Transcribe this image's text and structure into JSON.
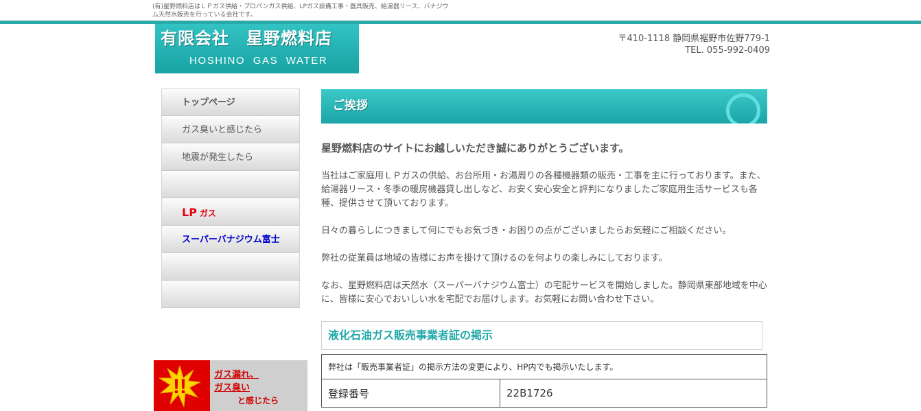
{
  "header": {
    "tagline": "(有)星野燃料店はＬＰガス供給・プロパンガス供給、LPガス設備工事・器具販売、給湯器リース、バナジウム天然水販売を行っている会社です。",
    "logo_name": "有限会社　星野燃料店",
    "logo_sub": "HOSHINO  GAS  WATER",
    "address": "〒410-1118 静岡県裾野市佐野779-1",
    "tel": "TEL. 055-992-0409",
    "accent_color": "#2aa9a9"
  },
  "nav": {
    "items": [
      {
        "label": "トップページ"
      },
      {
        "label": "ガス臭いと感じたら"
      },
      {
        "label": "地震が発生したら"
      },
      {
        "label": ""
      },
      {
        "label_big": "LP",
        "label_small": "ガス"
      },
      {
        "label": "スーパーバナジウム富士"
      },
      {
        "label": ""
      },
      {
        "label": ""
      }
    ]
  },
  "leak_banner": {
    "line1": "ガス漏れ、",
    "line2": "ガス臭い",
    "line3": "と感じたら"
  },
  "main": {
    "heading": "ご挨拶",
    "lead": "星野燃料店のサイトにお越しいただき誠にありがとうございます。",
    "paragraphs": [
      "当社はご家庭用ＬＰガスの供給、お台所用・お湯周りの各種機器類の販売・工事を主に行っております。また、給湯器リース・冬季の暖房機器貸し出しなど、お安く安心安全と評判になりましたご家庭用生活サービスも各種、提供させて頂いております。",
      "日々の暮らしにつきまして何にでもお気づき・お困りの点がございましたらお気軽にご相談ください。",
      "弊社の従業員は地域の皆様にお声を掛けて頂けるのを何よりの楽しみにしております。",
      "なお、星野燃料店は天然水（スーパーバナジウム富士）の宅配サービスを開始しました。静岡県東部地域を中心に、皆様に安心でおいしい水を宅配でお届けします。お気軽にお問い合わせ下さい。"
    ],
    "sub_heading": "液化石油ガス販売事業者証の掲示",
    "cert": {
      "note": "弊社は「販売事業者証」の掲示方法の変更により、HP内でも掲示いたします。",
      "rows": [
        {
          "key": "登録番号",
          "value": "22B1726"
        }
      ]
    }
  }
}
